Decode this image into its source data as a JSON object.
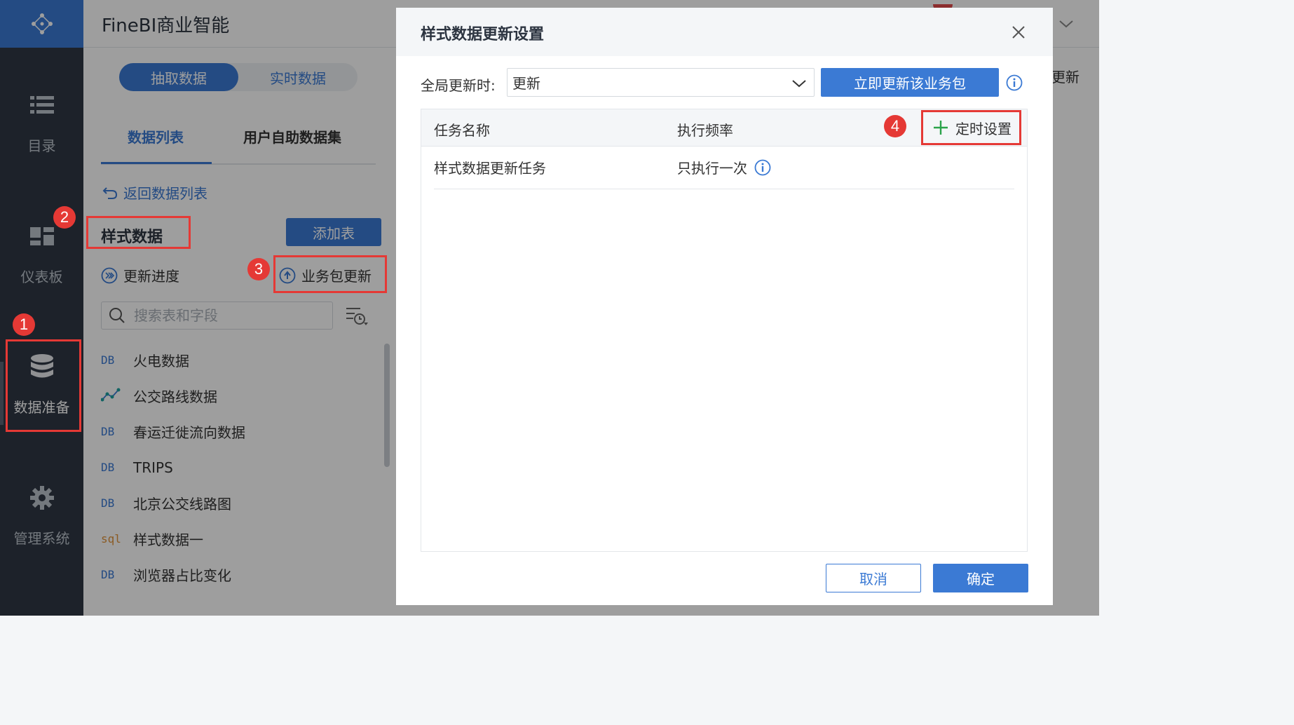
{
  "app": {
    "title": "FineBI商业智能"
  },
  "nav": {
    "items": [
      {
        "label": "目录",
        "icon": "list-icon"
      },
      {
        "label": "仪表板",
        "icon": "dashboard-icon"
      },
      {
        "label": "数据准备",
        "icon": "database-icon",
        "active": true
      },
      {
        "label": "管理系统",
        "icon": "gear-icon"
      }
    ]
  },
  "panel": {
    "mode_tabs": [
      "抽取数据",
      "实时数据"
    ],
    "active_mode": "抽取数据",
    "tabs": [
      "数据列表",
      "用户自助数据集"
    ],
    "active_tab": "数据列表",
    "back_link": "返回数据列表",
    "package_name": "样式数据",
    "add_table": "添加表",
    "update_progress": "更新进度",
    "package_update": "业务包更新",
    "search_placeholder": "搜索表和字段",
    "tables": [
      {
        "kind": "DB",
        "name": "火电数据"
      },
      {
        "kind": "self-service",
        "name": "公交路线数据"
      },
      {
        "kind": "DB",
        "name": "春运迁徙流向数据"
      },
      {
        "kind": "DB",
        "name": "TRIPS"
      },
      {
        "kind": "DB",
        "name": "北京公交线路图"
      },
      {
        "kind": "sql",
        "name": "样式数据一"
      },
      {
        "kind": "DB",
        "name": "浏览器占比变化"
      }
    ]
  },
  "background": {
    "right_update_label": "更新"
  },
  "dialog": {
    "title": "样式数据更新设置",
    "global_update_label": "全局更新时:",
    "global_update_value": "更新",
    "update_now": "立即更新该业务包",
    "table": {
      "col_name": "任务名称",
      "col_freq": "执行频率",
      "schedule_button": "定时设置",
      "rows": [
        {
          "name": "样式数据更新任务",
          "freq": "只执行一次"
        }
      ]
    },
    "cancel": "取消",
    "ok": "确定"
  },
  "annotations": [
    "1",
    "2",
    "3",
    "4"
  ],
  "colors": {
    "accent": "#3b7ad4",
    "nav_bg": "#2f3845",
    "highlight": "#e53935"
  }
}
